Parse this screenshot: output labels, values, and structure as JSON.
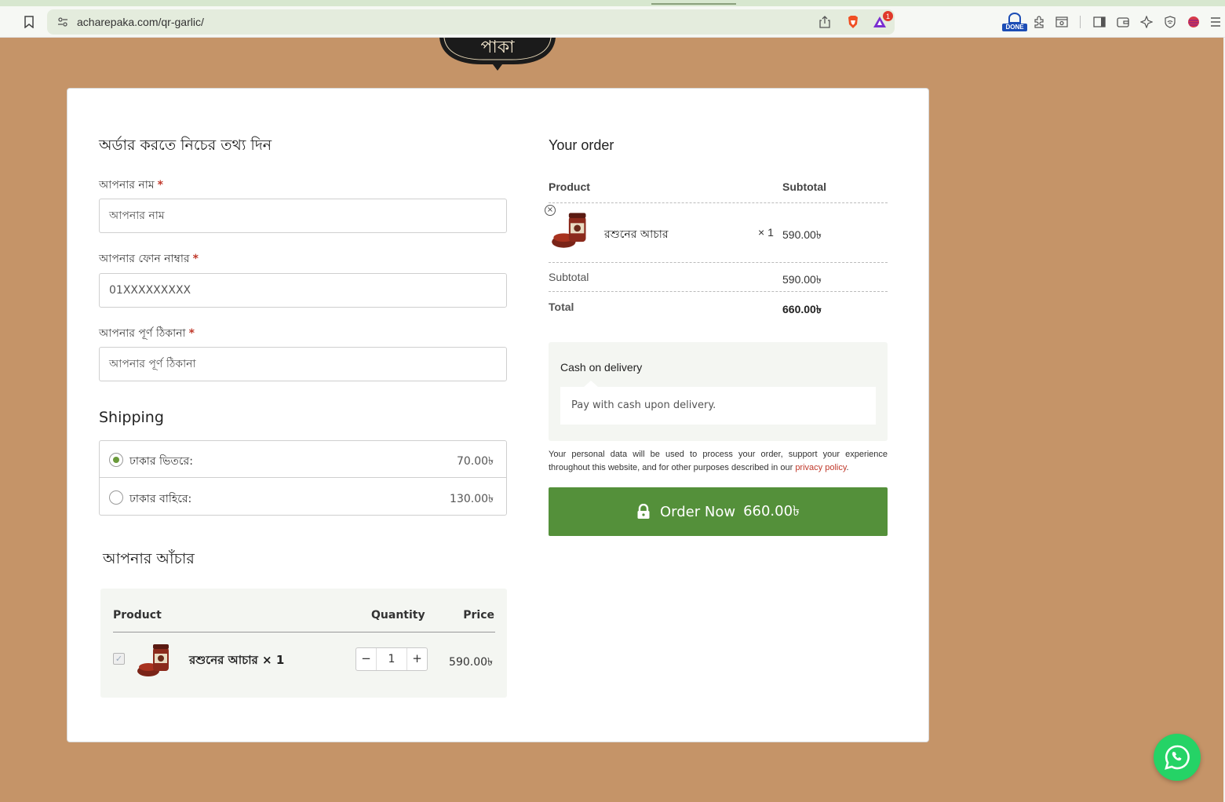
{
  "browser": {
    "url": "acharepaka.com/qr-garlic/",
    "rewards_badge": "1",
    "extension_done_label": "DONE"
  },
  "logo": {
    "text": "পাকা"
  },
  "form": {
    "title": "অর্ডার করতে নিচের তথ্য দিন",
    "name_label": "আপনার নাম",
    "name_placeholder": "আপনার নাম",
    "phone_label": "আপনার ফোন নাম্বার",
    "phone_placeholder": "01XXXXXXXXX",
    "address_label": "আপনার পূর্ণ ঠিকানা",
    "address_placeholder": "আপনার পূর্ণ ঠিকানা",
    "required_mark": "*"
  },
  "shipping": {
    "title": "Shipping",
    "options": [
      {
        "name": "ঢাকার ভিতরে:",
        "price": "70.00৳",
        "selected": true
      },
      {
        "name": "ঢাকার বাহিরে:",
        "price": "130.00৳",
        "selected": false
      }
    ]
  },
  "product_picker": {
    "title": "আপনার আঁচার",
    "col_product": "Product",
    "col_quantity": "Quantity",
    "col_price": "Price",
    "item": {
      "name": "রশুনের আচার × 1",
      "quantity": "1",
      "price": "590.00৳",
      "checked": true,
      "minus": "−",
      "plus": "+"
    }
  },
  "order": {
    "title": "Your order",
    "col_product": "Product",
    "col_subtotal": "Subtotal",
    "item_name": "রশুনের আচার",
    "item_qty": "× 1",
    "item_subtotal": "590.00৳",
    "subtotal_label": "Subtotal",
    "subtotal_value": "590.00৳",
    "total_label": "Total",
    "total_value": "660.00৳"
  },
  "payment": {
    "method": "Cash on delivery",
    "description": "Pay with cash upon delivery."
  },
  "privacy": {
    "text": "Your personal data will be used to process your order, support your experience throughout this website, and for other purposes described in our ",
    "link": "privacy policy",
    "end": "."
  },
  "order_button": {
    "label": "Order Now",
    "amount": "660.00৳"
  },
  "colors": {
    "page_bg": "#c59468",
    "accent_green": "#54903a",
    "required_red": "#c0392b",
    "whatsapp": "#25d366"
  }
}
